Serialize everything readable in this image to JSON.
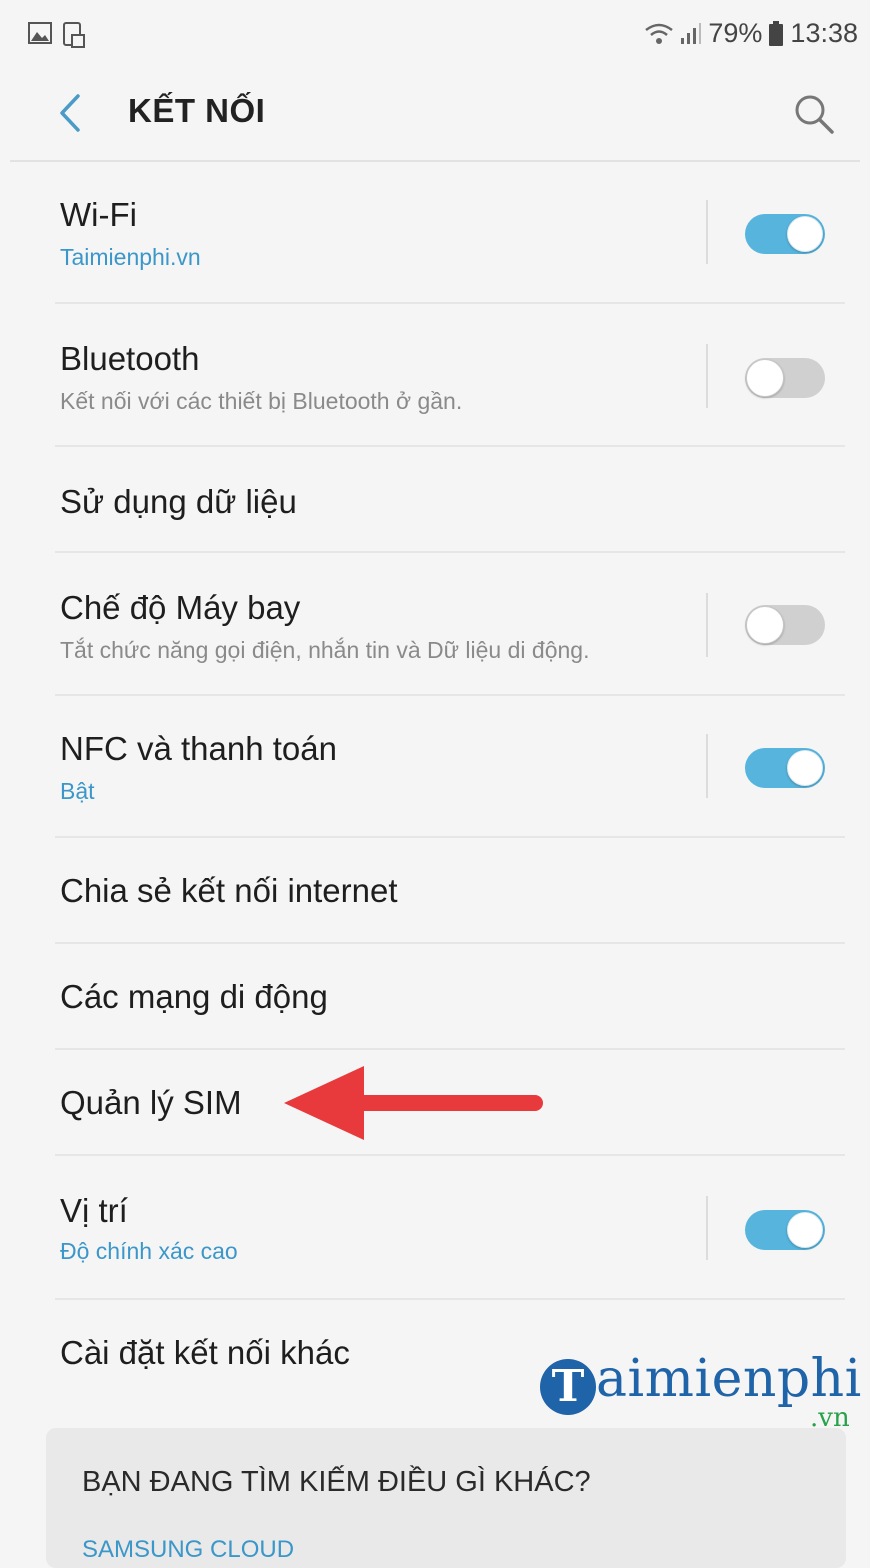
{
  "status_bar": {
    "battery": "79%",
    "time": "13:38",
    "icons": [
      "gallery-icon",
      "screenshot-icon",
      "wifi-icon",
      "signal-icon",
      "battery-icon"
    ]
  },
  "app_bar": {
    "title": "KẾT NỐI",
    "back_icon": "chevron-left-icon",
    "search_icon": "search-icon"
  },
  "settings": [
    {
      "title": "Wi-Fi",
      "subtitle": "Taimienphi.vn",
      "subtitle_color": "blue",
      "toggle": "on"
    },
    {
      "title": "Bluetooth",
      "subtitle": "Kết nối với các thiết bị Bluetooth ở gần.",
      "subtitle_color": "gray",
      "toggle": "off"
    },
    {
      "title": "Sử dụng dữ liệu"
    },
    {
      "title": "Chế độ Máy bay",
      "subtitle": "Tắt chức năng gọi điện, nhắn tin và Dữ liệu di động.",
      "subtitle_color": "gray",
      "toggle": "off"
    },
    {
      "title": "NFC và thanh toán",
      "subtitle": "Bật",
      "subtitle_color": "blue",
      "toggle": "on"
    },
    {
      "title": "Chia sẻ kết nối internet"
    },
    {
      "title": "Các mạng di động"
    },
    {
      "title": "Quản lý SIM"
    },
    {
      "title": "Vị trí",
      "subtitle": "Độ chính xác cao",
      "subtitle_color": "blue",
      "toggle": "on"
    },
    {
      "title": "Cài đặt kết nối khác"
    }
  ],
  "annotation": {
    "arrow_color": "#e83a3d"
  },
  "watermark": {
    "initial": "T",
    "name": "aimienphi",
    "suffix": ".vn"
  },
  "suggestion_card": {
    "title": "BẠN ĐANG TÌM KIẾM ĐIỀU GÌ KHÁC?",
    "link": "SAMSUNG CLOUD"
  },
  "colors": {
    "accent": "#56b4dd",
    "link": "#3b97c9",
    "background": "#f5f5f5"
  }
}
